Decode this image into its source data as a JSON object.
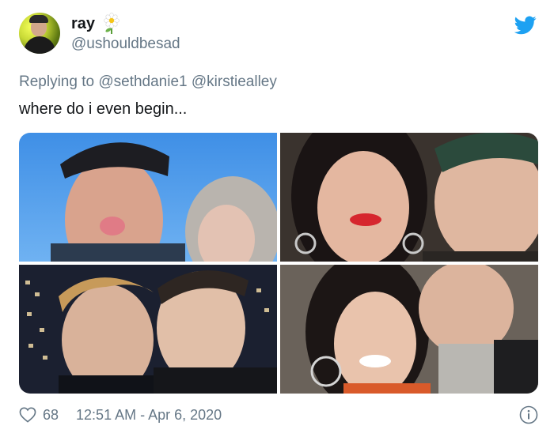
{
  "user": {
    "display_name": "ray",
    "handle": "@ushouldbesad",
    "emoji_icon": "daisy-flower-icon",
    "avatar_icon": "avatar"
  },
  "reply": {
    "prefix": "Replying to",
    "mentions": [
      "@sethdanie1",
      "@kirstiealley"
    ]
  },
  "tweet_text": "where do i even begin...",
  "media": {
    "photos": [
      {
        "name": "photo-top-left"
      },
      {
        "name": "photo-top-right"
      },
      {
        "name": "photo-bottom-left"
      },
      {
        "name": "photo-bottom-right"
      }
    ]
  },
  "footer": {
    "like_count": "68",
    "timestamp": "12:51 AM - Apr 6, 2020"
  },
  "colors": {
    "twitter_blue": "#1da1f2",
    "secondary_text": "#657786",
    "primary_text": "#14171a"
  }
}
